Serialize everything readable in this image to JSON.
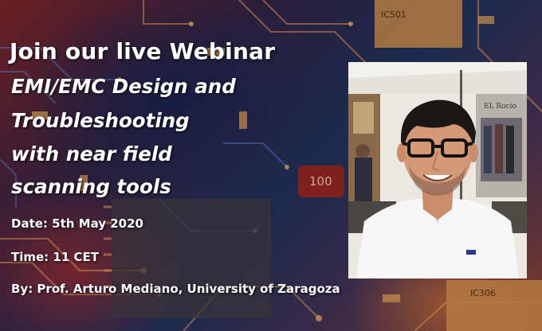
{
  "headline": "Join our live Webinar",
  "subtitle_lines": [
    "EMI/EMC Design  and",
    "Troubleshooting",
    "with near field",
    "scanning tools"
  ],
  "date_line": "Date: 5th May 2020",
  "time_line": "Time:  11 CET",
  "speaker_line": "By: Prof. Arturo Mediano, University of Zaragoza",
  "pcb_labels": {
    "chip_top": "IC501",
    "chip_bottom": "IC306",
    "component": "100"
  },
  "photo_sign": "EL Rocio",
  "colors": {
    "text": "#ffffff",
    "bg_red": "#6a1f22",
    "bg_blue": "#1c2a4e",
    "chip_copper": "#c98a4a"
  }
}
